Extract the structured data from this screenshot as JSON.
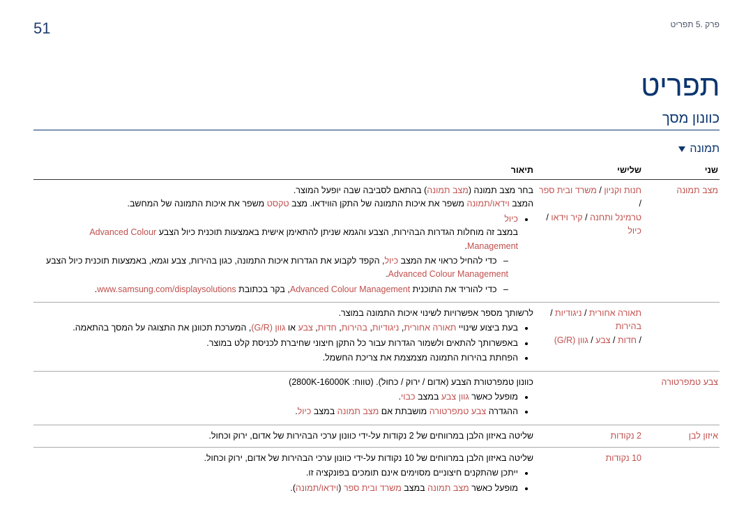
{
  "header": {
    "chapter_label": "פרק .5 תפריט",
    "page_number": "51"
  },
  "titles": {
    "main": "תפריט",
    "sub": "כוונון מסך",
    "section": "תמונה"
  },
  "table": {
    "headers": {
      "c1": "שני",
      "c2": "שלישי",
      "c3": "תיאור"
    },
    "rows": {
      "r1": {
        "c1": "מצב תמונה",
        "c2a": "חנות וקניון",
        "c2sep1": " / ",
        "c2b": "משרד ובית ספר",
        "c2sep2": " / ",
        "c2c": "טרמינל ותחנה",
        "c2sep3": " / ",
        "c2d": "קיר וידאו",
        "c2sep4": " / ",
        "c2e": "כיול",
        "c3_line1_pre": "בחר מצב תמונה (",
        "c3_line1_mid": "מצב תמונה",
        "c3_line1_post": ") בהתאם לסביבה שבה יופעל המוצר.",
        "c3_line2_pre": "המצב ",
        "c3_line2_a": "וידאו/תמונה",
        "c3_line2_mid": " משפר את איכות התמונה של התקן הווידאו. מצב ",
        "c3_line2_b": "טקסט",
        "c3_line2_post": " משפר את איכות התמונה של המחשב.",
        "c3_bullet_label": "כיול",
        "c3_bullet_line_a": "במצב זה מוחלות הגדרות הבהירות, הצבע והגמא שניתן להתאימן אישית באמצעות תוכנית כיול הצבע ",
        "c3_bullet_line_b": "Advanced Colour Management",
        "c3_bullet_line_b_post": ".",
        "c3_sub1_pre": "כדי להחיל כראוי את המצב ",
        "c3_sub1_a": "כיול",
        "c3_sub1_post": ", הקפד לקבוע את הגדרות איכות התמונה, כגון בהירות, צבע וגמא, באמצעות תוכנית כיול הצבע ",
        "c3_sub1_b": "Advanced Colour Management",
        "c3_sub1_b_post": ".",
        "c3_sub2_pre": "כדי להוריד את התוכנית ",
        "c3_sub2_a": "Advanced Colour Management",
        "c3_sub2_post": ", בקר בכתובת ",
        "c3_sub2_link": "www.samsung.com/displaysolutions",
        "c3_sub2_end": "."
      },
      "r2": {
        "c1": "",
        "c2a": "תאורה אחורית",
        "c2sep1": " / ",
        "c2b": "ניגודיות",
        "c2sep2": " / ",
        "c2c": "בהירות",
        "c2sep3": " / ",
        "c2d": "חדות",
        "c2sep4": " / ",
        "c2e": "צבע",
        "c2sep5": " / ",
        "c2f": "גוון (G/R)",
        "c3_line": "לרשותך מספר אפשרויות לשינוי איכות התמונה במוצר.",
        "c3_b1_pre": "בעת ביצוע שינויי ",
        "c3_b1_a": "תאורה אחורית",
        "c3_b1_s1": ", ",
        "c3_b1_b": "ניגודיות",
        "c3_b1_s2": ", ",
        "c3_b1_c": "בהירות",
        "c3_b1_s3": ", ",
        "c3_b1_d": "חדות",
        "c3_b1_s4": ", ",
        "c3_b1_e": "צבע",
        "c3_b1_s5": " או ",
        "c3_b1_f": "גוון (G/R)",
        "c3_b1_post": ", המערכת תכוונן את התצוגה על המסך בהתאמה.",
        "c3_b2": "באפשרותך להתאים ולשמור הגדרות עבור כל התקן חיצוני שחיברת לכניסת קלט במוצר.",
        "c3_b3": "הפחתת בהירות התמונה מצמצמת את צריכת החשמל."
      },
      "r3": {
        "c1": "צבע טמפרטורה",
        "c2": "",
        "c3_line": "כוונון טמפרטורת הצבע (אדום / ירוק / כחול). (טווח: 2800K-16000K)",
        "c3_b1_pre": "מופעל כאשר ",
        "c3_b1_a": "גוון צבע",
        "c3_b1_mid": " במצב ",
        "c3_b1_b": "כבוי",
        "c3_b1_post": ".",
        "c3_b2_pre": "ההגדרה ",
        "c3_b2_a": "צבע טמפרטורה",
        "c3_b2_mid": " מושבתת אם ",
        "c3_b2_b": "מצב תמונה",
        "c3_b2_mid2": " במצב ",
        "c3_b2_c": "כיול",
        "c3_b2_post": "."
      },
      "r4": {
        "c1": "איזון לבן",
        "c2": "2 נקודות",
        "c3": "שליטה באיזון הלבן במרווחים של 2 נקודות על-ידי כוונון ערכי הבהירות של אדום, ירוק וכחול."
      },
      "r5": {
        "c1": "",
        "c2": "10 נקודות",
        "c3_line": "שליטה באיזון הלבן במרווחים של 10 נקודות על-ידי כוונון ערכי הבהירות של אדום, ירוק וכחול.",
        "c3_b1": "ייתכן שהתקנים חיצוניים מסוימים אינם תומכים בפונקציה זו.",
        "c3_b2_pre": "מופעל כאשר ",
        "c3_b2_a": "מצב תמונה",
        "c3_b2_mid": " במצב ",
        "c3_b2_b": "משרד ובית ספר",
        "c3_b2_mid2": " (",
        "c3_b2_c": "וידאו/תמונה",
        "c3_b2_post": ")."
      }
    }
  }
}
